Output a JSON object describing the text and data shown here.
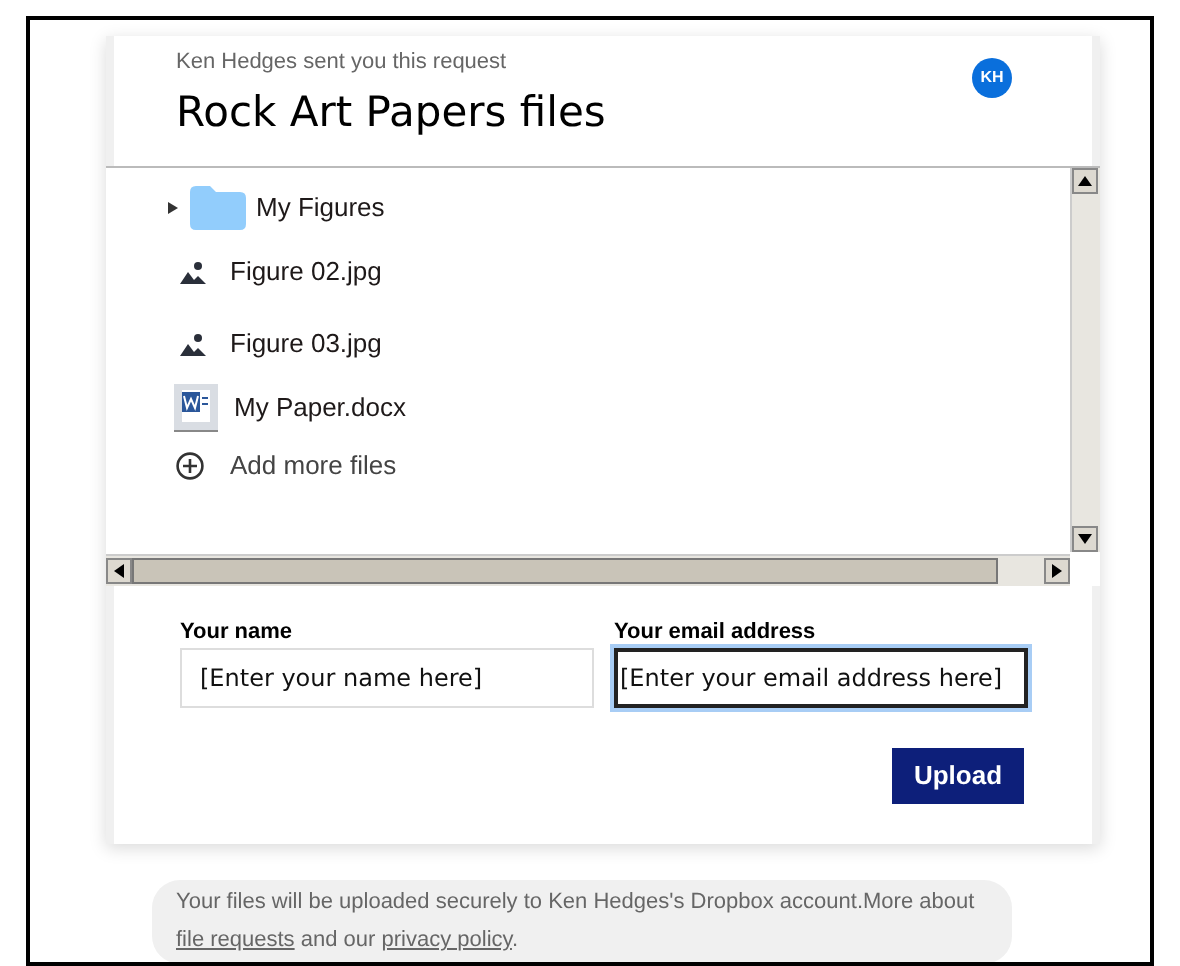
{
  "header": {
    "sender_line": "Ken Hedges sent you this request",
    "avatar": "KH",
    "title": "Rock Art Papers files"
  },
  "files": [
    {
      "kind": "folder",
      "name": "My Figures",
      "expanded": false
    },
    {
      "kind": "image",
      "name": "Figure 02.jpg"
    },
    {
      "kind": "image",
      "name": "Figure 03.jpg"
    },
    {
      "kind": "word",
      "name": "My Paper.docx"
    },
    {
      "kind": "add",
      "name": "Add more files"
    }
  ],
  "form": {
    "fields": [
      {
        "label": "Your name",
        "placeholder": "[Enter your name here]",
        "focused": false
      },
      {
        "label": "Your email address",
        "placeholder": "[Enter your email address here]",
        "focused": true
      }
    ],
    "button": "Upload"
  },
  "footer": [
    {
      "kind": "text",
      "text": "Your files will be uploaded securely to Ken Hedges's Dropbox account.More about"
    },
    {
      "kind": "link",
      "text": "file requests"
    },
    {
      "kind": "text",
      "text": "and our"
    },
    {
      "kind": "link",
      "text": "privacy policy"
    },
    {
      "kind": "text",
      "text": "."
    }
  ]
}
